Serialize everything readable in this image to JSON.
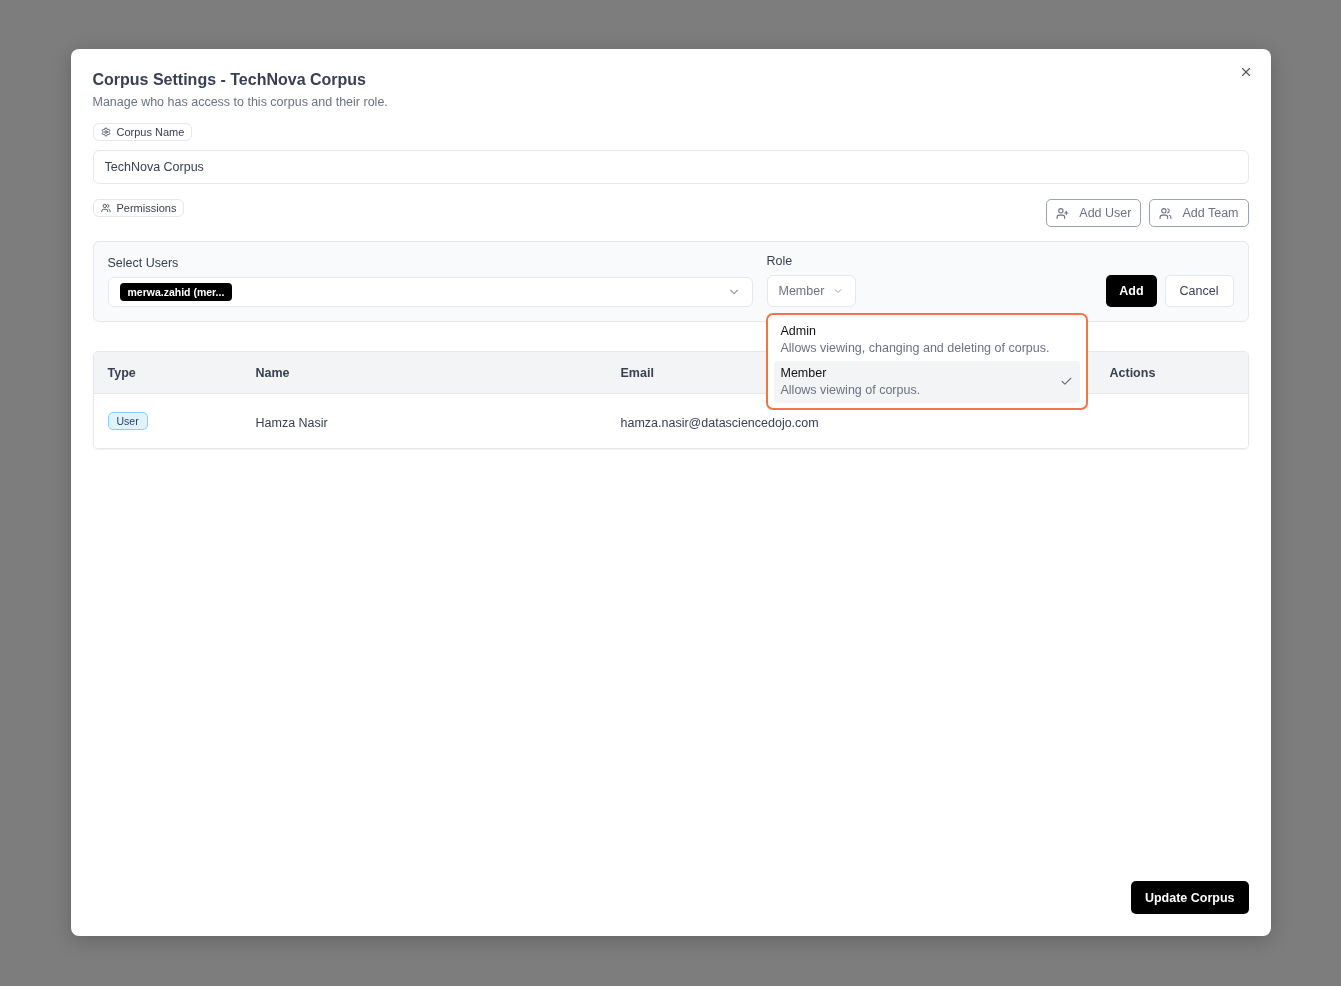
{
  "dialog": {
    "title": "Corpus Settings - TechNova Corpus",
    "subtitle": "Manage who has access to this corpus and their role."
  },
  "corpus_name": {
    "label": "Corpus Name",
    "value": "TechNova Corpus"
  },
  "permissions": {
    "label": "Permissions",
    "buttons": [
      {
        "label": "Add User",
        "kind": "user"
      },
      {
        "label": "Add Team",
        "kind": "team"
      }
    ]
  },
  "add_form": {
    "users_label": "Select Users",
    "selected_users": [
      "merwa.zahid (mer..."
    ],
    "role_label": "Role",
    "role_value": "Member",
    "add": "Add",
    "cancel": "Cancel",
    "role_menu": [
      {
        "name": "Admin",
        "description": "Allows viewing, changing and deleting of corpus.",
        "selected": false
      },
      {
        "name": "Member",
        "description": "Allows viewing of corpus.",
        "selected": true
      }
    ]
  },
  "table": {
    "columns": [
      "Type",
      "Name",
      "Email",
      "Actions"
    ],
    "rows": [
      {
        "type": "User",
        "name": "Hamza Nasir",
        "email": "hamza.nasir@datasciencedojo.com"
      }
    ]
  },
  "footer": {
    "submit": "Update Corpus"
  }
}
